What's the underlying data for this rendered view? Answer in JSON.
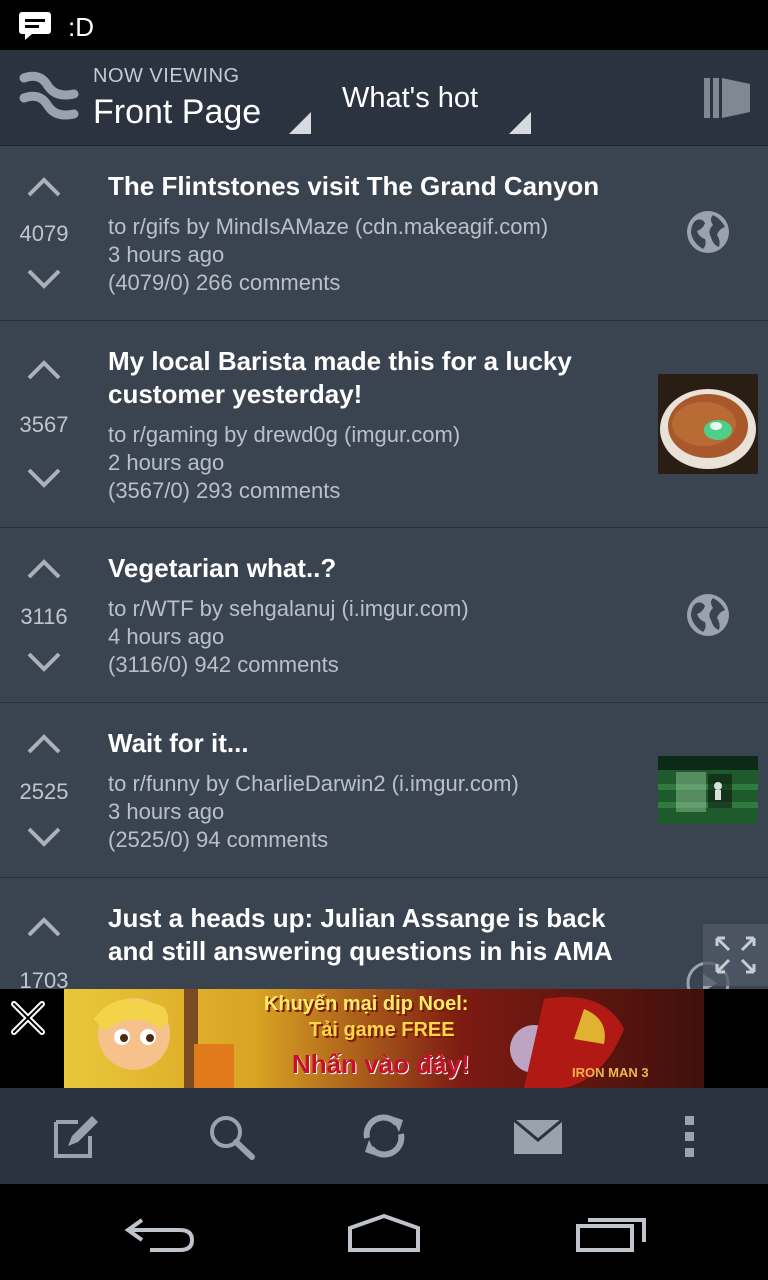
{
  "status_bar": {
    "notification_text": ":D"
  },
  "action_bar": {
    "now_viewing_label": "NOW VIEWING",
    "subreddit": "Front Page",
    "sort": "What's hot"
  },
  "posts": [
    {
      "score": "4079",
      "title": "The Flintstones visit The Grand Canyon",
      "byline": "to r/gifs by MindIsAMaze (cdn.makeagif.com)",
      "age": "3 hours ago",
      "stats": "(4079/0) 266 comments",
      "thumbnail": "globe-icon"
    },
    {
      "score": "3567",
      "title": "My local Barista made this for a lucky customer yesterday!",
      "byline": "to r/gaming by drewd0g (imgur.com)",
      "age": "2 hours ago",
      "stats": "(3567/0) 293 comments",
      "thumbnail": "coffee-image"
    },
    {
      "score": "3116",
      "title": "Vegetarian what..?",
      "byline": "to r/WTF by sehgalanuj (i.imgur.com)",
      "age": "4 hours ago",
      "stats": "(3116/0) 942 comments",
      "thumbnail": "globe-icon"
    },
    {
      "score": "2525",
      "title": "Wait for it...",
      "byline": "to r/funny by CharlieDarwin2 (i.imgur.com)",
      "age": "3 hours ago",
      "stats": "(2525/0) 94 comments",
      "thumbnail": "soccer-game-image"
    },
    {
      "score": "1703",
      "title": "Just a heads up: Julian Assange is back and still answering questions in his AMA",
      "byline": "",
      "age": "",
      "stats": "",
      "thumbnail": "play-icon"
    }
  ],
  "ad": {
    "line1": "Khuyến mại dịp Noel:",
    "line2": "Tải game FREE",
    "line3": "Nhấn vào đây!",
    "corner": "IRON MAN 3"
  },
  "toolbar": [
    "compose-icon",
    "search-icon",
    "refresh-icon",
    "mail-icon",
    "overflow-menu-icon"
  ],
  "navigation": [
    "back-icon",
    "home-icon",
    "recent-apps-icon"
  ],
  "colors": {
    "background": "#3a4350",
    "bar": "#2b3340",
    "text_muted": "#b9c0c9"
  }
}
